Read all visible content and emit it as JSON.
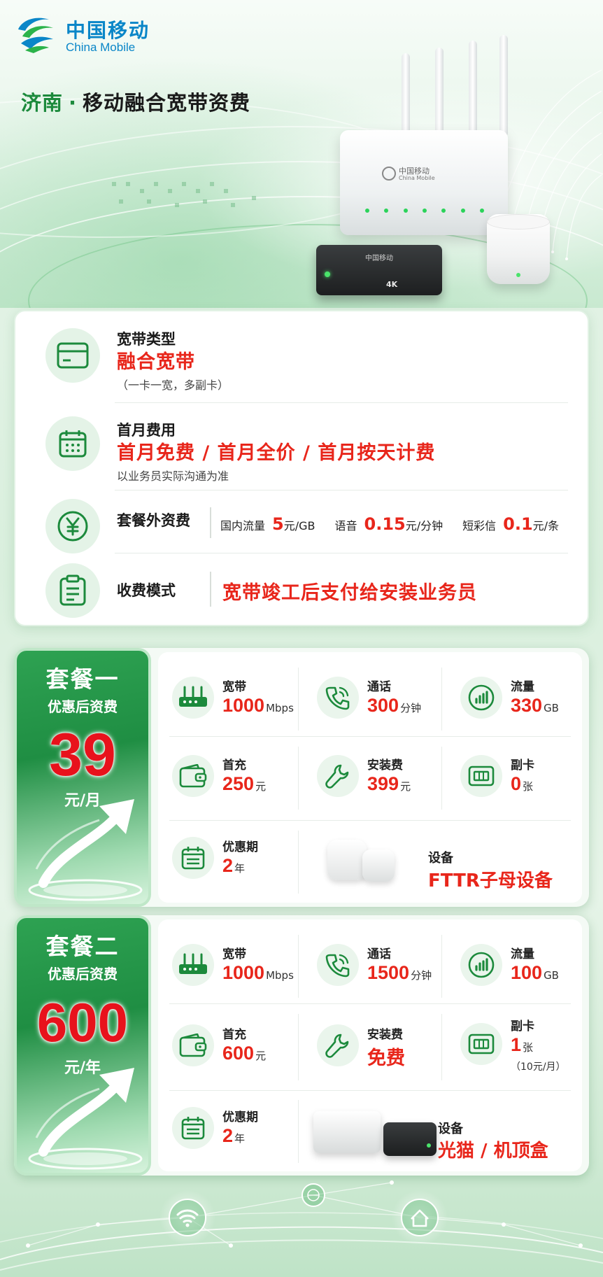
{
  "brand": {
    "name_cn": "中国移动",
    "name_en": "China Mobile"
  },
  "header": {
    "city": "济南",
    "separator": "·",
    "title": "移动融合宽带资费"
  },
  "devices": {
    "router_brand": "中国移动",
    "router_brand_en": "China Mobile",
    "stb_brand": "中国移动",
    "stb_badge": "4K"
  },
  "info": {
    "broadband_type": {
      "label": "宽带类型",
      "value": "融合宽带",
      "note": "（一卡一宽，多副卡）",
      "icon": "card-icon"
    },
    "first_month": {
      "label": "首月费用",
      "value": "首月免费 / 首月全价 / 首月按天计费",
      "note": "以业务员实际沟通为准",
      "icon": "calendar-icon"
    },
    "extra_fees": {
      "label": "套餐外资费",
      "icon": "yuan-icon",
      "items": [
        {
          "name": "国内流量",
          "value": "5",
          "unit": "元/GB"
        },
        {
          "name": "语音",
          "value": "0.15",
          "unit": "元/分钟"
        },
        {
          "name": "短彩信",
          "value": "0.1",
          "unit": "元/条"
        }
      ]
    },
    "billing_mode": {
      "label": "收费模式",
      "value": "宽带竣工后支付给安装业务员",
      "icon": "clipboard-icon"
    }
  },
  "plans": [
    {
      "name": "套餐一",
      "sub": "优惠后资费",
      "price": "39",
      "price_unit": "元/月",
      "broadband": {
        "label": "宽带",
        "value": "1000",
        "unit": "Mbps"
      },
      "calls": {
        "label": "通话",
        "value": "300",
        "unit": "分钟"
      },
      "data": {
        "label": "流量",
        "value": "330",
        "unit": "GB"
      },
      "recharge": {
        "label": "首充",
        "value": "250",
        "unit": "元"
      },
      "install": {
        "label": "安装费",
        "value": "399",
        "unit": "元"
      },
      "sub_card": {
        "label": "副卡",
        "value": "0",
        "unit": "张",
        "note": ""
      },
      "promo": {
        "label": "优惠期",
        "value": "2",
        "unit": "年"
      },
      "device": {
        "label": "设备",
        "value": "FTTR子母设备"
      }
    },
    {
      "name": "套餐二",
      "sub": "优惠后资费",
      "price": "600",
      "price_unit": "元/年",
      "broadband": {
        "label": "宽带",
        "value": "1000",
        "unit": "Mbps"
      },
      "calls": {
        "label": "通话",
        "value": "1500",
        "unit": "分钟"
      },
      "data": {
        "label": "流量",
        "value": "100",
        "unit": "GB"
      },
      "recharge": {
        "label": "首充",
        "value": "600",
        "unit": "元"
      },
      "install": {
        "label": "安装费",
        "value": "免费",
        "unit": ""
      },
      "sub_card": {
        "label": "副卡",
        "value": "1",
        "unit": "张",
        "note": "（10元/月）"
      },
      "promo": {
        "label": "优惠期",
        "value": "2",
        "unit": "年"
      },
      "device": {
        "label": "设备",
        "value": "光猫 / 机顶盒"
      }
    }
  ],
  "colors": {
    "brand_blue": "#0a86c8",
    "accent_green": "#1c8a3c",
    "price_red": "#e8261b"
  }
}
